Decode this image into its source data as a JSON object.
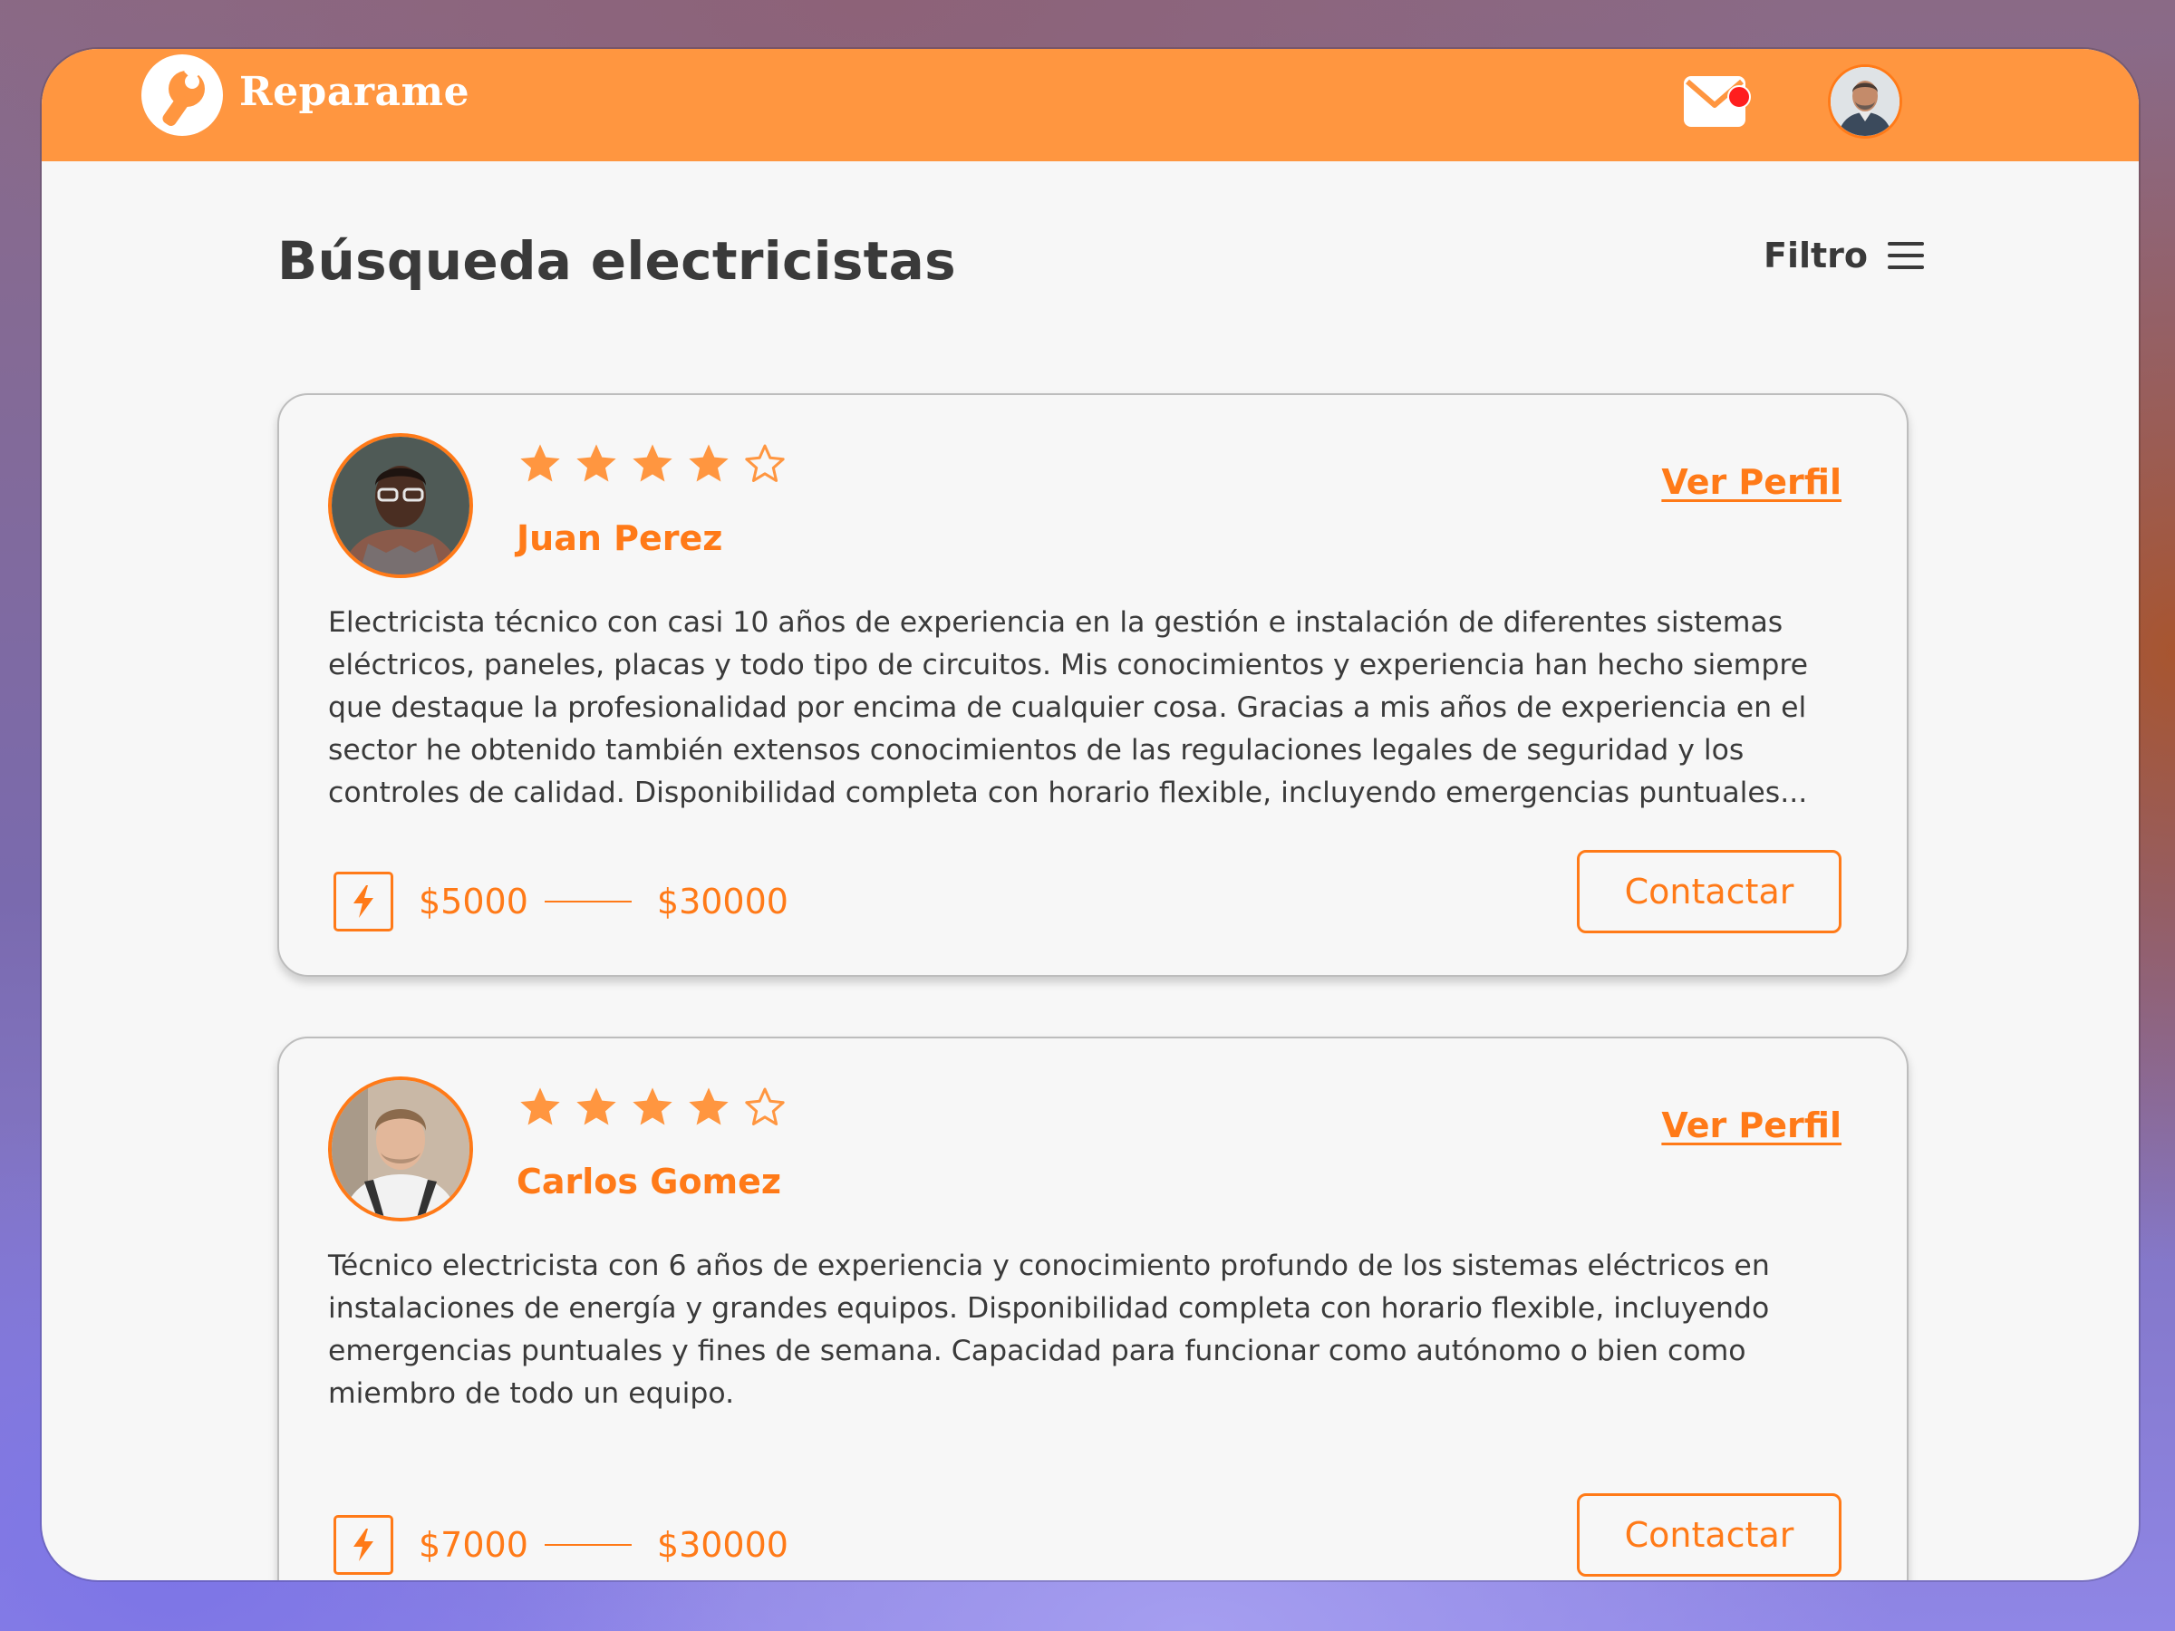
{
  "app": {
    "name": "Reparame",
    "logo_icon": "wrench-icon",
    "brand_color": "#ff9640",
    "accent_color": "#ff7a18"
  },
  "header": {
    "mail_icon": "mail-icon",
    "notification_badge": "notification-dot",
    "avatar": "user-avatar"
  },
  "page": {
    "title": "Búsqueda electricistas",
    "filter_label": "Filtro",
    "filter_icon": "menu-icon"
  },
  "cards": [
    {
      "name": "Juan Perez",
      "rating": 4,
      "rating_max": 5,
      "profile_link": "Ver Perfil",
      "description": "Electricista técnico con casi 10 años de experiencia en la gestión e instalación de diferentes sistemas eléctricos, paneles, placas y todo tipo de circuitos. Mis conocimientos y experiencia han hecho siempre que destaque la profesionalidad por encima de cualquier cosa. Gracias a mis años de experiencia en el sector he obtenido también extensos conocimientos de las regulaciones legales de seguridad y los controles de calidad. Disponibilidad completa con horario flexible, incluyendo emergencias puntuales...",
      "price_min": "$5000",
      "price_max": "$30000",
      "contact_label": "Contactar",
      "category_icon": "lightning-bolt-icon"
    },
    {
      "name": "Carlos Gomez",
      "rating": 4,
      "rating_max": 5,
      "profile_link": "Ver Perfil",
      "description": "Técnico electricista con 6 años de experiencia y conocimiento profundo de los sistemas eléctricos en instalaciones de energía y grandes equipos. Disponibilidad completa con horario flexible, incluyendo emergencias puntuales y fines de semana. Capacidad para funcionar como autónomo o bien como miembro de todo un equipo.",
      "price_min": "$7000",
      "price_max": "$30000",
      "contact_label": "Contactar",
      "category_icon": "lightning-bolt-icon"
    }
  ]
}
